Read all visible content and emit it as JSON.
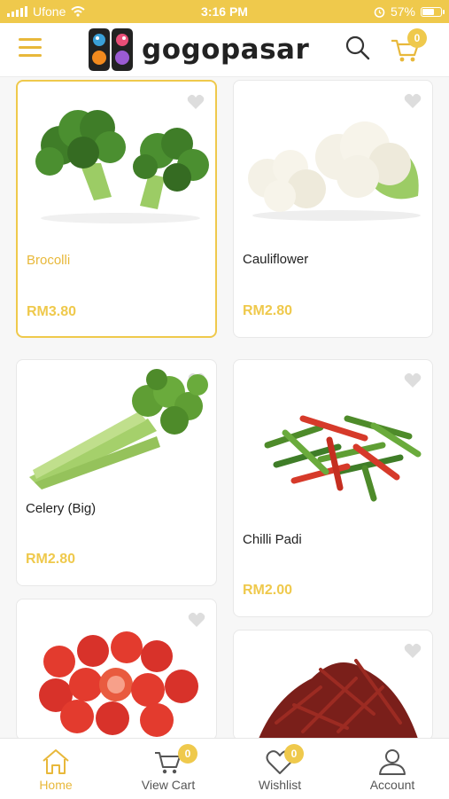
{
  "status": {
    "carrier": "Ufone",
    "time": "3:16 PM",
    "battery": "57%",
    "battery_level": 0.57
  },
  "header": {
    "logo_text": "gogopasar",
    "cart_count": "0"
  },
  "products": [
    {
      "name": "Brocolli",
      "price": "RM3.80",
      "selected": true
    },
    {
      "name": "Cauliflower",
      "price": "RM2.80",
      "selected": false
    },
    {
      "name": "Celery (Big)",
      "price": "RM2.80",
      "selected": false
    },
    {
      "name": "Chilli Padi",
      "price": "RM2.00",
      "selected": false
    }
  ],
  "tabbar": {
    "home": "Home",
    "view_cart": "View Cart",
    "cart_count": "0",
    "wishlist": "Wishlist",
    "wishlist_count": "0",
    "account": "Account"
  },
  "colors": {
    "accent": "#efc94c",
    "accent_dark": "#e8b83a"
  },
  "icons": [
    "menu-icon",
    "search-icon",
    "cart-icon",
    "heart-icon",
    "home-icon",
    "user-icon",
    "wifi-icon",
    "alarm-icon",
    "battery-icon"
  ]
}
